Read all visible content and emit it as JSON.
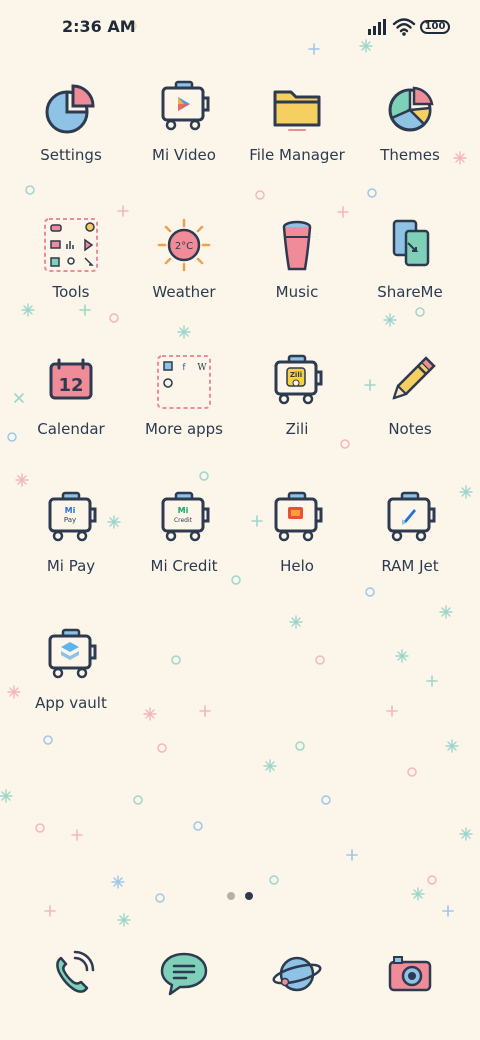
{
  "status_bar": {
    "time": "2:36 AM",
    "battery": "100",
    "icons": [
      "signal-icon",
      "wifi-icon",
      "battery-icon"
    ]
  },
  "apps": [
    {
      "label": "Settings",
      "icon": "settings-icon"
    },
    {
      "label": "Mi Video",
      "icon": "mi-video-icon"
    },
    {
      "label": "File Manager",
      "icon": "file-manager-icon"
    },
    {
      "label": "Themes",
      "icon": "themes-icon"
    },
    {
      "label": "Tools",
      "icon": "tools-icon"
    },
    {
      "label": "Weather",
      "icon": "weather-icon",
      "icon_text": "2°C"
    },
    {
      "label": "Music",
      "icon": "music-icon"
    },
    {
      "label": "ShareMe",
      "icon": "shareme-icon"
    },
    {
      "label": "Calendar",
      "icon": "calendar-icon",
      "icon_text": "12"
    },
    {
      "label": "More apps",
      "icon": "more-apps-icon"
    },
    {
      "label": "Zili",
      "icon": "zili-icon",
      "icon_text": "Zili"
    },
    {
      "label": "Notes",
      "icon": "notes-icon"
    },
    {
      "label": "Mi Pay",
      "icon": "mi-pay-icon",
      "icon_text": "Pay"
    },
    {
      "label": "Mi Credit",
      "icon": "mi-credit-icon",
      "icon_text": "Credit"
    },
    {
      "label": "Helo",
      "icon": "helo-icon"
    },
    {
      "label": "RAM Jet",
      "icon": "ram-jet-icon"
    },
    {
      "label": "App vault",
      "icon": "app-vault-icon"
    }
  ],
  "dock": [
    {
      "icon": "phone-icon"
    },
    {
      "icon": "messages-icon"
    },
    {
      "icon": "browser-icon"
    },
    {
      "icon": "camera-icon"
    }
  ],
  "page_indicator": {
    "pages": 2,
    "current": 2
  },
  "colors": {
    "background": "#fbf6e9",
    "outline": "#2d3a4f",
    "pink": "#f08c98",
    "blue": "#8ec3e6",
    "yellow": "#f5cf5f",
    "green": "#7fd0b8"
  }
}
